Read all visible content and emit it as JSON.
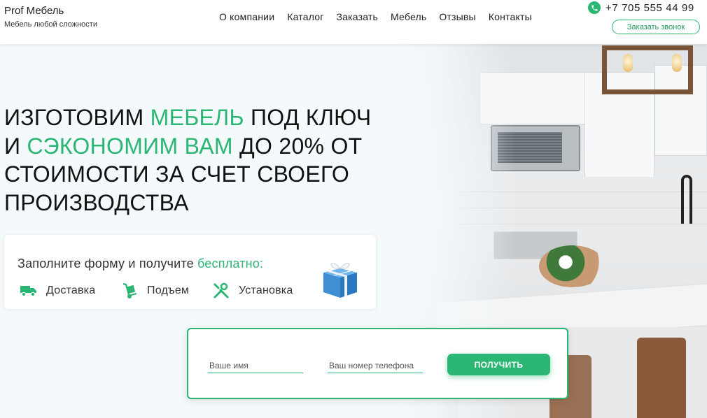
{
  "header": {
    "logo_title": "Prof Мебель",
    "logo_subtitle": "Мебель любой сложности",
    "nav": [
      "О компании",
      "Каталог",
      "Заказать",
      "Мебель",
      "Отзывы",
      "Контакты"
    ],
    "phone": "+7 705 555 44 99",
    "phone_icon": "whatsapp-icon",
    "call_button": "Заказать звонок"
  },
  "hero": {
    "line1_a": "Изготовим ",
    "line1_b": "мебель",
    "line1_c": " под ключ",
    "line2_a": "и ",
    "line2_b": "сэкономим вам",
    "line2_c": " до 20% от",
    "line3": "стоимости за счет своего",
    "line4": "производства"
  },
  "offer": {
    "title_a": "Заполните форму и получите ",
    "title_b": "бесплатно:",
    "perks": [
      {
        "label": "Доставка",
        "icon": "truck-icon"
      },
      {
        "label": "Подъем",
        "icon": "hand-truck-icon"
      },
      {
        "label": "Установка",
        "icon": "tools-icon"
      }
    ],
    "gift_icon": "gift-box-icon"
  },
  "form": {
    "name_placeholder": "Ваше имя",
    "phone_placeholder": "Ваш номер телефона",
    "submit": "ПОЛУЧИТЬ"
  },
  "colors": {
    "accent": "#2bb673",
    "background": "#f4f9fb",
    "text": "#111111"
  }
}
